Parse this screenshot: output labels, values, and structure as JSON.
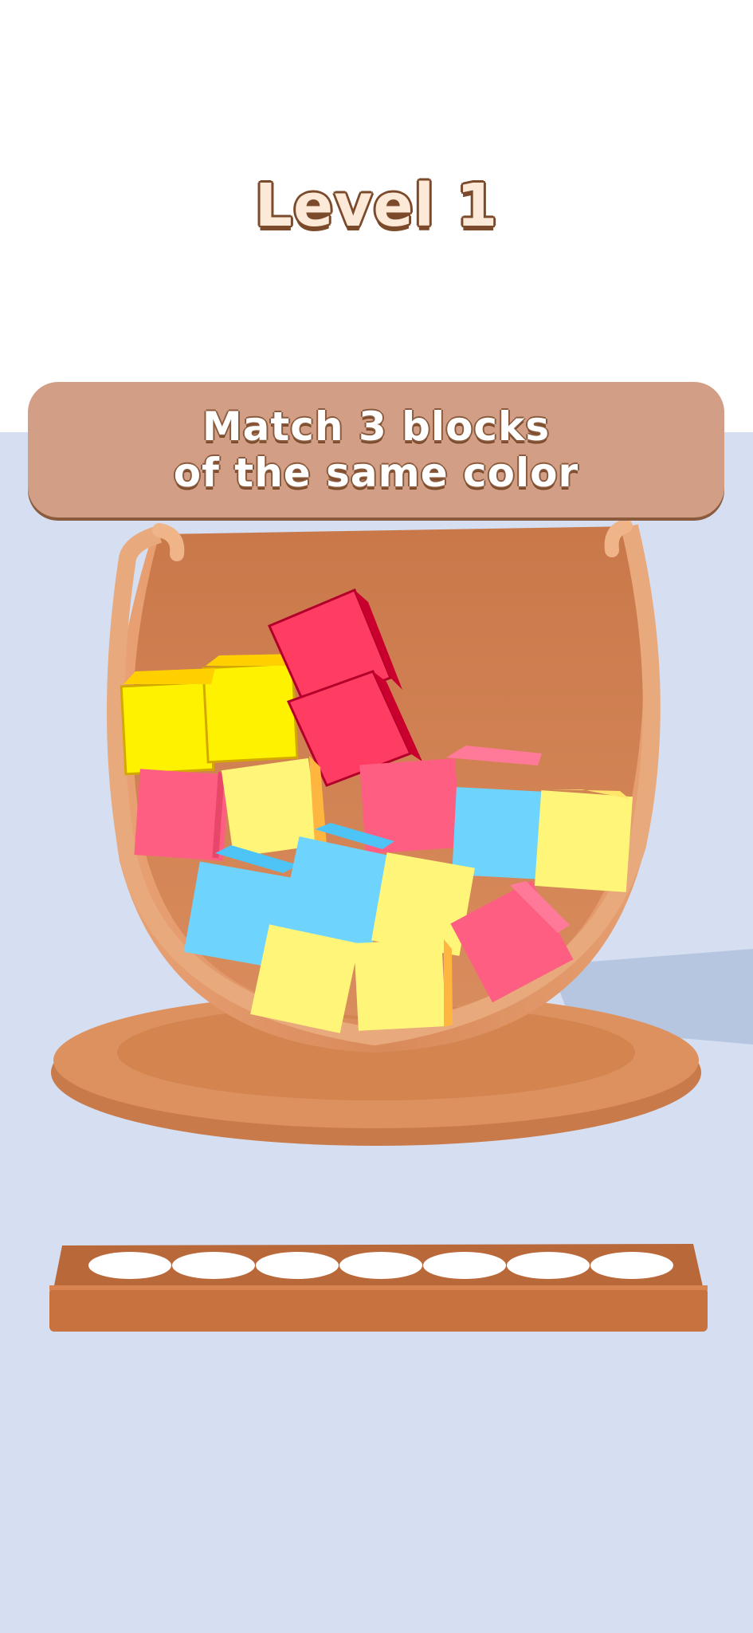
{
  "header": {
    "level_label": "Level 1"
  },
  "instruction": {
    "line1": "Match 3 blocks",
    "line2": "of the same color"
  },
  "colors": {
    "background": "#d5dff1",
    "wood": "#d98a5a",
    "banner": "#d29f86",
    "block_yellow": "#fff36a",
    "block_red": "#ff3d62",
    "block_pink": "#ff5e83",
    "block_blue": "#6fd4fd",
    "tray_slot": "#ffffff"
  },
  "tray": {
    "slot_count": 7
  },
  "blocks": [
    {
      "color": "yellow"
    },
    {
      "color": "red"
    },
    {
      "color": "pink"
    },
    {
      "color": "yellow"
    },
    {
      "color": "pink"
    },
    {
      "color": "blue"
    },
    {
      "color": "yellow"
    },
    {
      "color": "blue"
    },
    {
      "color": "blue"
    },
    {
      "color": "yellow"
    },
    {
      "color": "pink"
    },
    {
      "color": "yellow"
    },
    {
      "color": "yellow"
    }
  ]
}
